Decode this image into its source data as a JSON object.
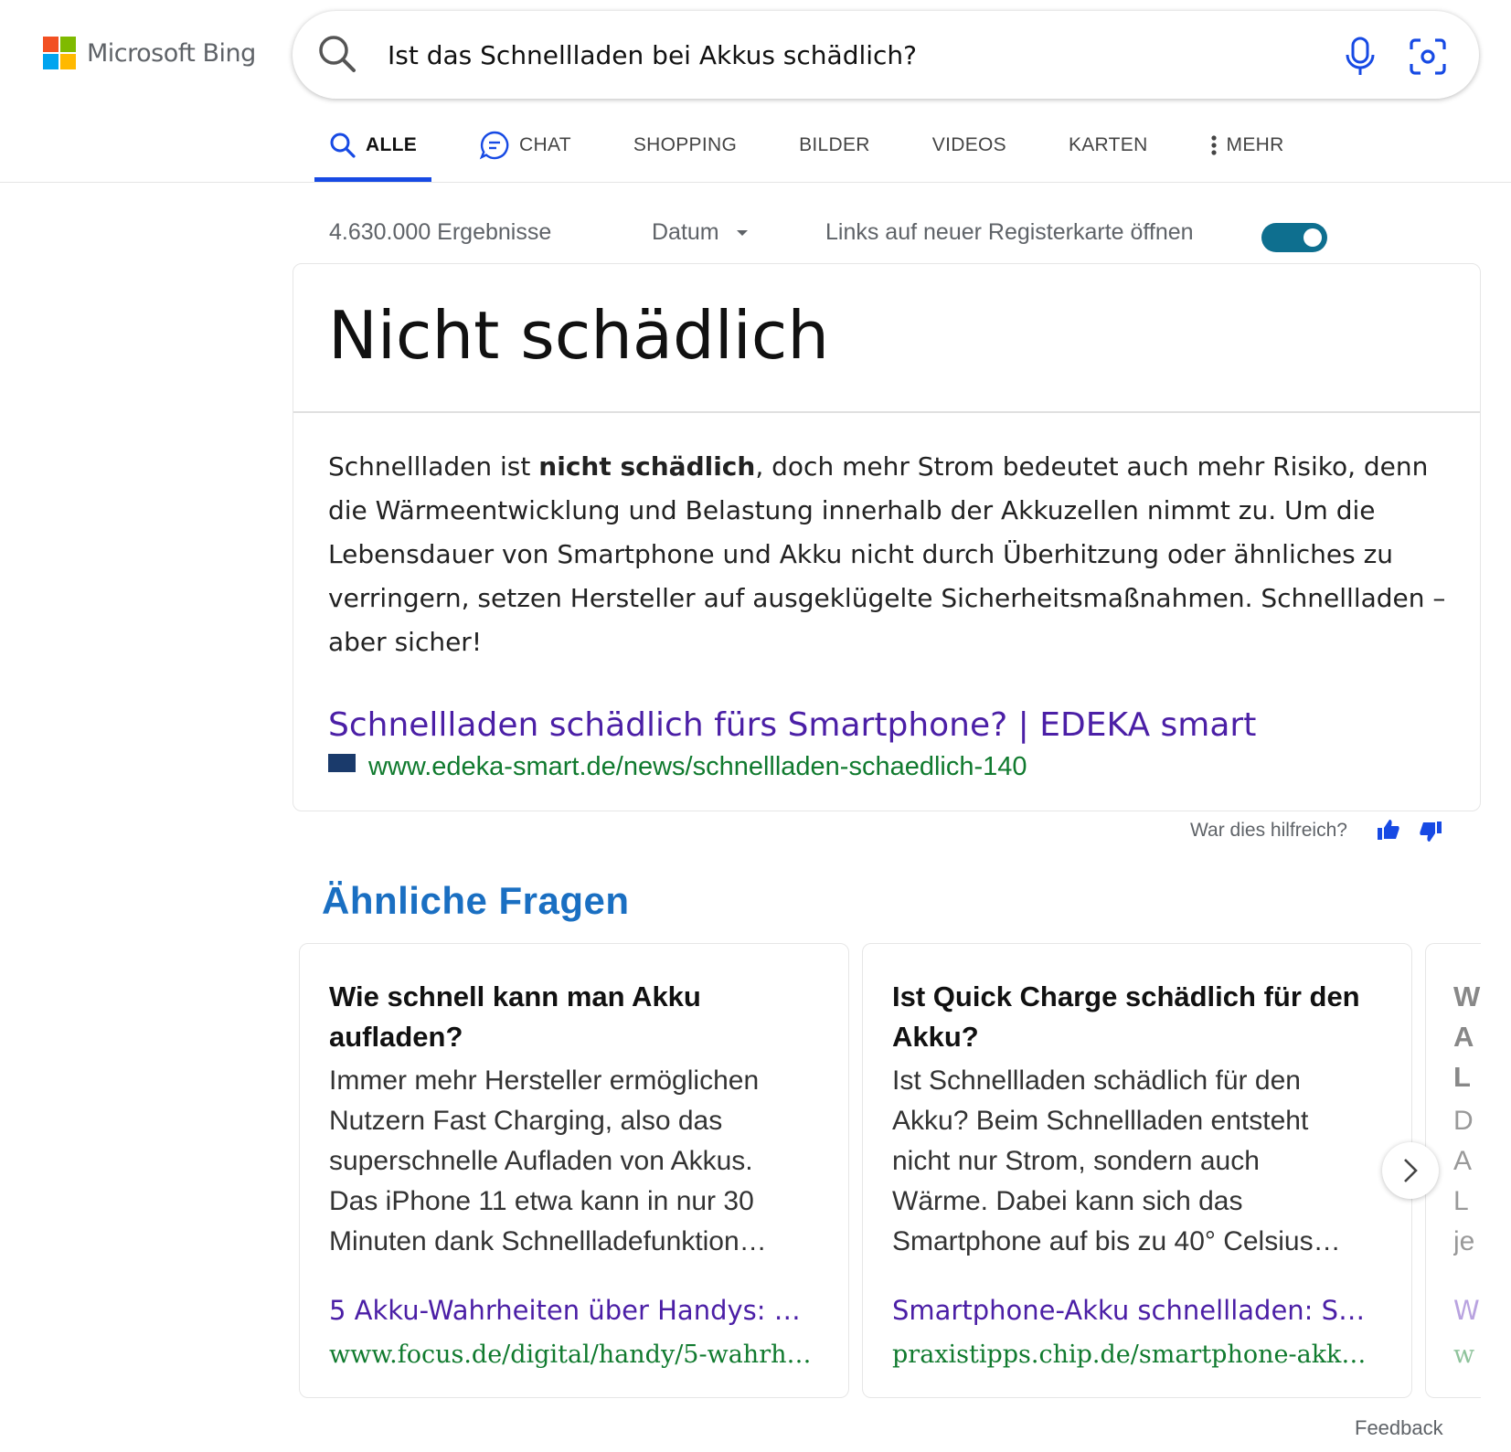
{
  "header": {
    "brand": "Microsoft Bing",
    "logo_colors": [
      "#f25022",
      "#7fba00",
      "#00a4ef",
      "#ffb900"
    ],
    "search_query": "Ist das Schnellladen bei Akkus schädlich?",
    "icons": [
      "search-icon",
      "microphone-icon",
      "visual-search-icon"
    ]
  },
  "tabs": [
    {
      "label": "ALLE",
      "active": true
    },
    {
      "label": "CHAT"
    },
    {
      "label": "SHOPPING"
    },
    {
      "label": "BILDER"
    },
    {
      "label": "VIDEOS"
    },
    {
      "label": "KARTEN"
    },
    {
      "label": "MEHR"
    }
  ],
  "results_bar": {
    "count": "4.630.000 Ergebnisse",
    "date_filter": "Datum",
    "new_tab_label": "Links auf neuer Registerkarte öffnen",
    "new_tab_enabled": true
  },
  "answer": {
    "title": "Nicht schädlich",
    "text_before_bold": "Schnellladen ist ",
    "text_bold": "nicht schädlich",
    "text_after_bold": ", doch mehr Strom bedeutet auch mehr Risiko, denn die Wärmeentwicklung und Belastung innerhalb der Akkuzellen nimmt zu. Um die Lebensdauer von Smartphone und Akku nicht durch Überhitzung oder ähnliches zu verringern, setzen Hersteller auf ausgeklügelte Sicherheitsmaßnahmen. Schnellladen – aber sicher!",
    "source_title": "Schnellladen schädlich fürs Smartphone? | EDEKA smart",
    "source_url": "www.edeka-smart.de/news/schnellladen-schaedlich-140"
  },
  "feedback_prompt": "War dies hilfreich?",
  "related": {
    "heading": "Ähnliche Fragen",
    "cards": [
      {
        "question": "Wie schnell kann man Akku aufladen?",
        "body_lines": [
          "Immer mehr Hersteller ermöglichen",
          "Nutzern Fast Charging, also das",
          "superschnelle Aufladen von Akkus.",
          "Das iPhone 11 etwa kann in nur 30",
          "Minuten dank Schnellladefunktion…"
        ],
        "link": "5 Akku-Wahrheiten über Handys: Sc…",
        "url": "www.focus.de/digital/handy/5-wahrhei…"
      },
      {
        "question": "Ist Quick Charge schädlich für den Akku?",
        "body_lines": [
          "Ist Schnellladen schädlich für den",
          "Akku? Beim Schnellladen entsteht",
          "nicht nur Strom, sondern auch",
          "Wärme. Dabei kann sich das",
          "Smartphone auf bis zu 40° Celsius…"
        ],
        "link": "Smartphone-Akku schnellladen: Sch…",
        "url": "praxistipps.chip.de/smartphone-akku-s…"
      },
      {
        "question": "W A L",
        "body_lines": [
          "D",
          "A",
          "L",
          "je"
        ],
        "link": "W",
        "url": "w"
      }
    ]
  },
  "footer": {
    "feedback": "Feedback"
  },
  "colors": {
    "accent_blue": "#174ae4",
    "link_purple": "#4b1fa6",
    "url_green": "#107a2e",
    "heading_blue": "#1a6fc2",
    "toggle_teal": "#0e6f8f"
  }
}
